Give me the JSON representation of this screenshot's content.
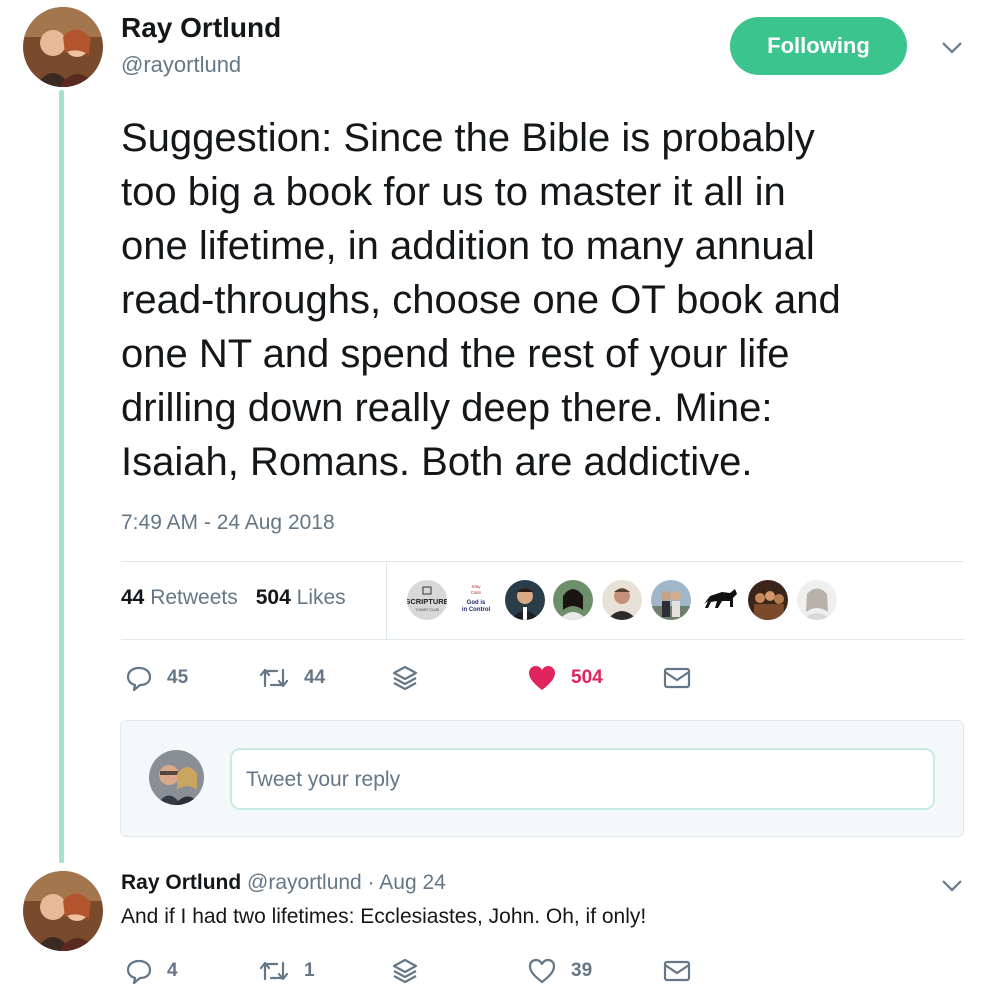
{
  "tweet": {
    "author_name": "Ray Ortlund",
    "author_handle": "@rayortlund",
    "follow_label": "Following",
    "text": "Suggestion: Since the Bible is probably\ntoo big a book for us to master it all in\none lifetime, in addition to many annual\nread-throughs, choose one OT book and\none NT and spend the rest of your life\ndrilling down really deep there. Mine:\nIsaiah, Romans. Both are addictive.",
    "timestamp": "7:49 AM - 24 Aug 2018",
    "retweets_count": "44",
    "retweets_label": "Retweets",
    "likes_count": "504",
    "likes_label": "Likes",
    "liker_texts": {
      "scripture_logo": "SCRIPTURE",
      "scripture_sub": "T-SHIRT CLUB",
      "stay_calm_top": "Stay",
      "stay_calm_bottom": "Calm",
      "god_in_control_1": "God is",
      "god_in_control_2": "in Control"
    },
    "actions": {
      "reply_count": "45",
      "retweet_count": "44",
      "like_count": "504"
    }
  },
  "reply_composer": {
    "placeholder": "Tweet your reply"
  },
  "reply_tweet": {
    "author_name": "Ray Ortlund",
    "author_handle": "@rayortlund",
    "separator": "·",
    "date": "Aug 24",
    "text": "And if I had two lifetimes: Ecclesiastes, John. Oh, if only!",
    "actions": {
      "reply_count": "4",
      "retweet_count": "1",
      "like_count": "39"
    }
  },
  "colors": {
    "accent": "#3cc48f",
    "thread_line": "#a3e2cb",
    "like": "#e0245e",
    "muted": "#657786"
  }
}
